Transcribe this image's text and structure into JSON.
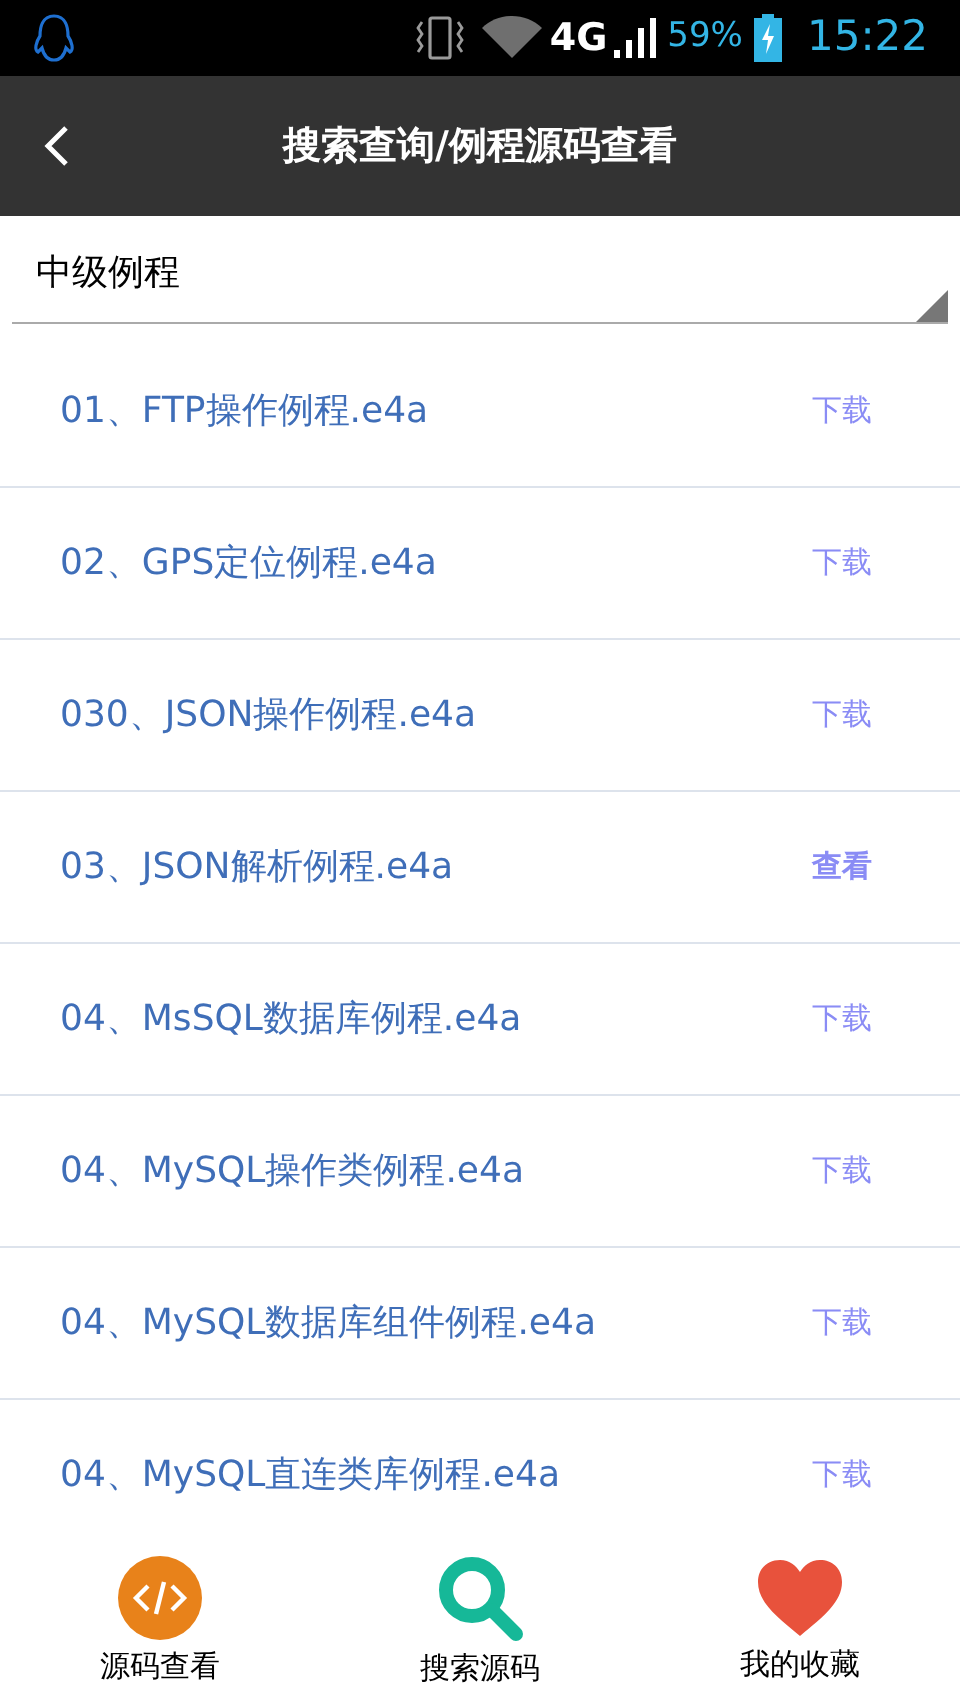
{
  "status_bar": {
    "network": "4G",
    "battery": "59%",
    "time": "15:22"
  },
  "header": {
    "title": "搜索查询/例程源码查看"
  },
  "dropdown": {
    "value": "中级例程"
  },
  "items": [
    {
      "name": "01、FTP操作例程.e4a",
      "action": "下载",
      "kind": "download"
    },
    {
      "name": "02、GPS定位例程.e4a",
      "action": "下载",
      "kind": "download"
    },
    {
      "name": "030、JSON操作例程.e4a",
      "action": "下载",
      "kind": "download"
    },
    {
      "name": "03、JSON解析例程.e4a",
      "action": "查看",
      "kind": "view"
    },
    {
      "name": "04、MsSQL数据库例程.e4a",
      "action": "下载",
      "kind": "download"
    },
    {
      "name": "04、MySQL操作类例程.e4a",
      "action": "下载",
      "kind": "download"
    },
    {
      "name": "04、MySQL数据库组件例程.e4a",
      "action": "下载",
      "kind": "download"
    },
    {
      "name": "04、MySQL直连类库例程.e4a",
      "action": "下载",
      "kind": "download"
    }
  ],
  "nav": [
    {
      "label": "源码查看",
      "kind": "code"
    },
    {
      "label": "搜索源码",
      "kind": "search"
    },
    {
      "label": "我的收藏",
      "kind": "heart"
    }
  ]
}
